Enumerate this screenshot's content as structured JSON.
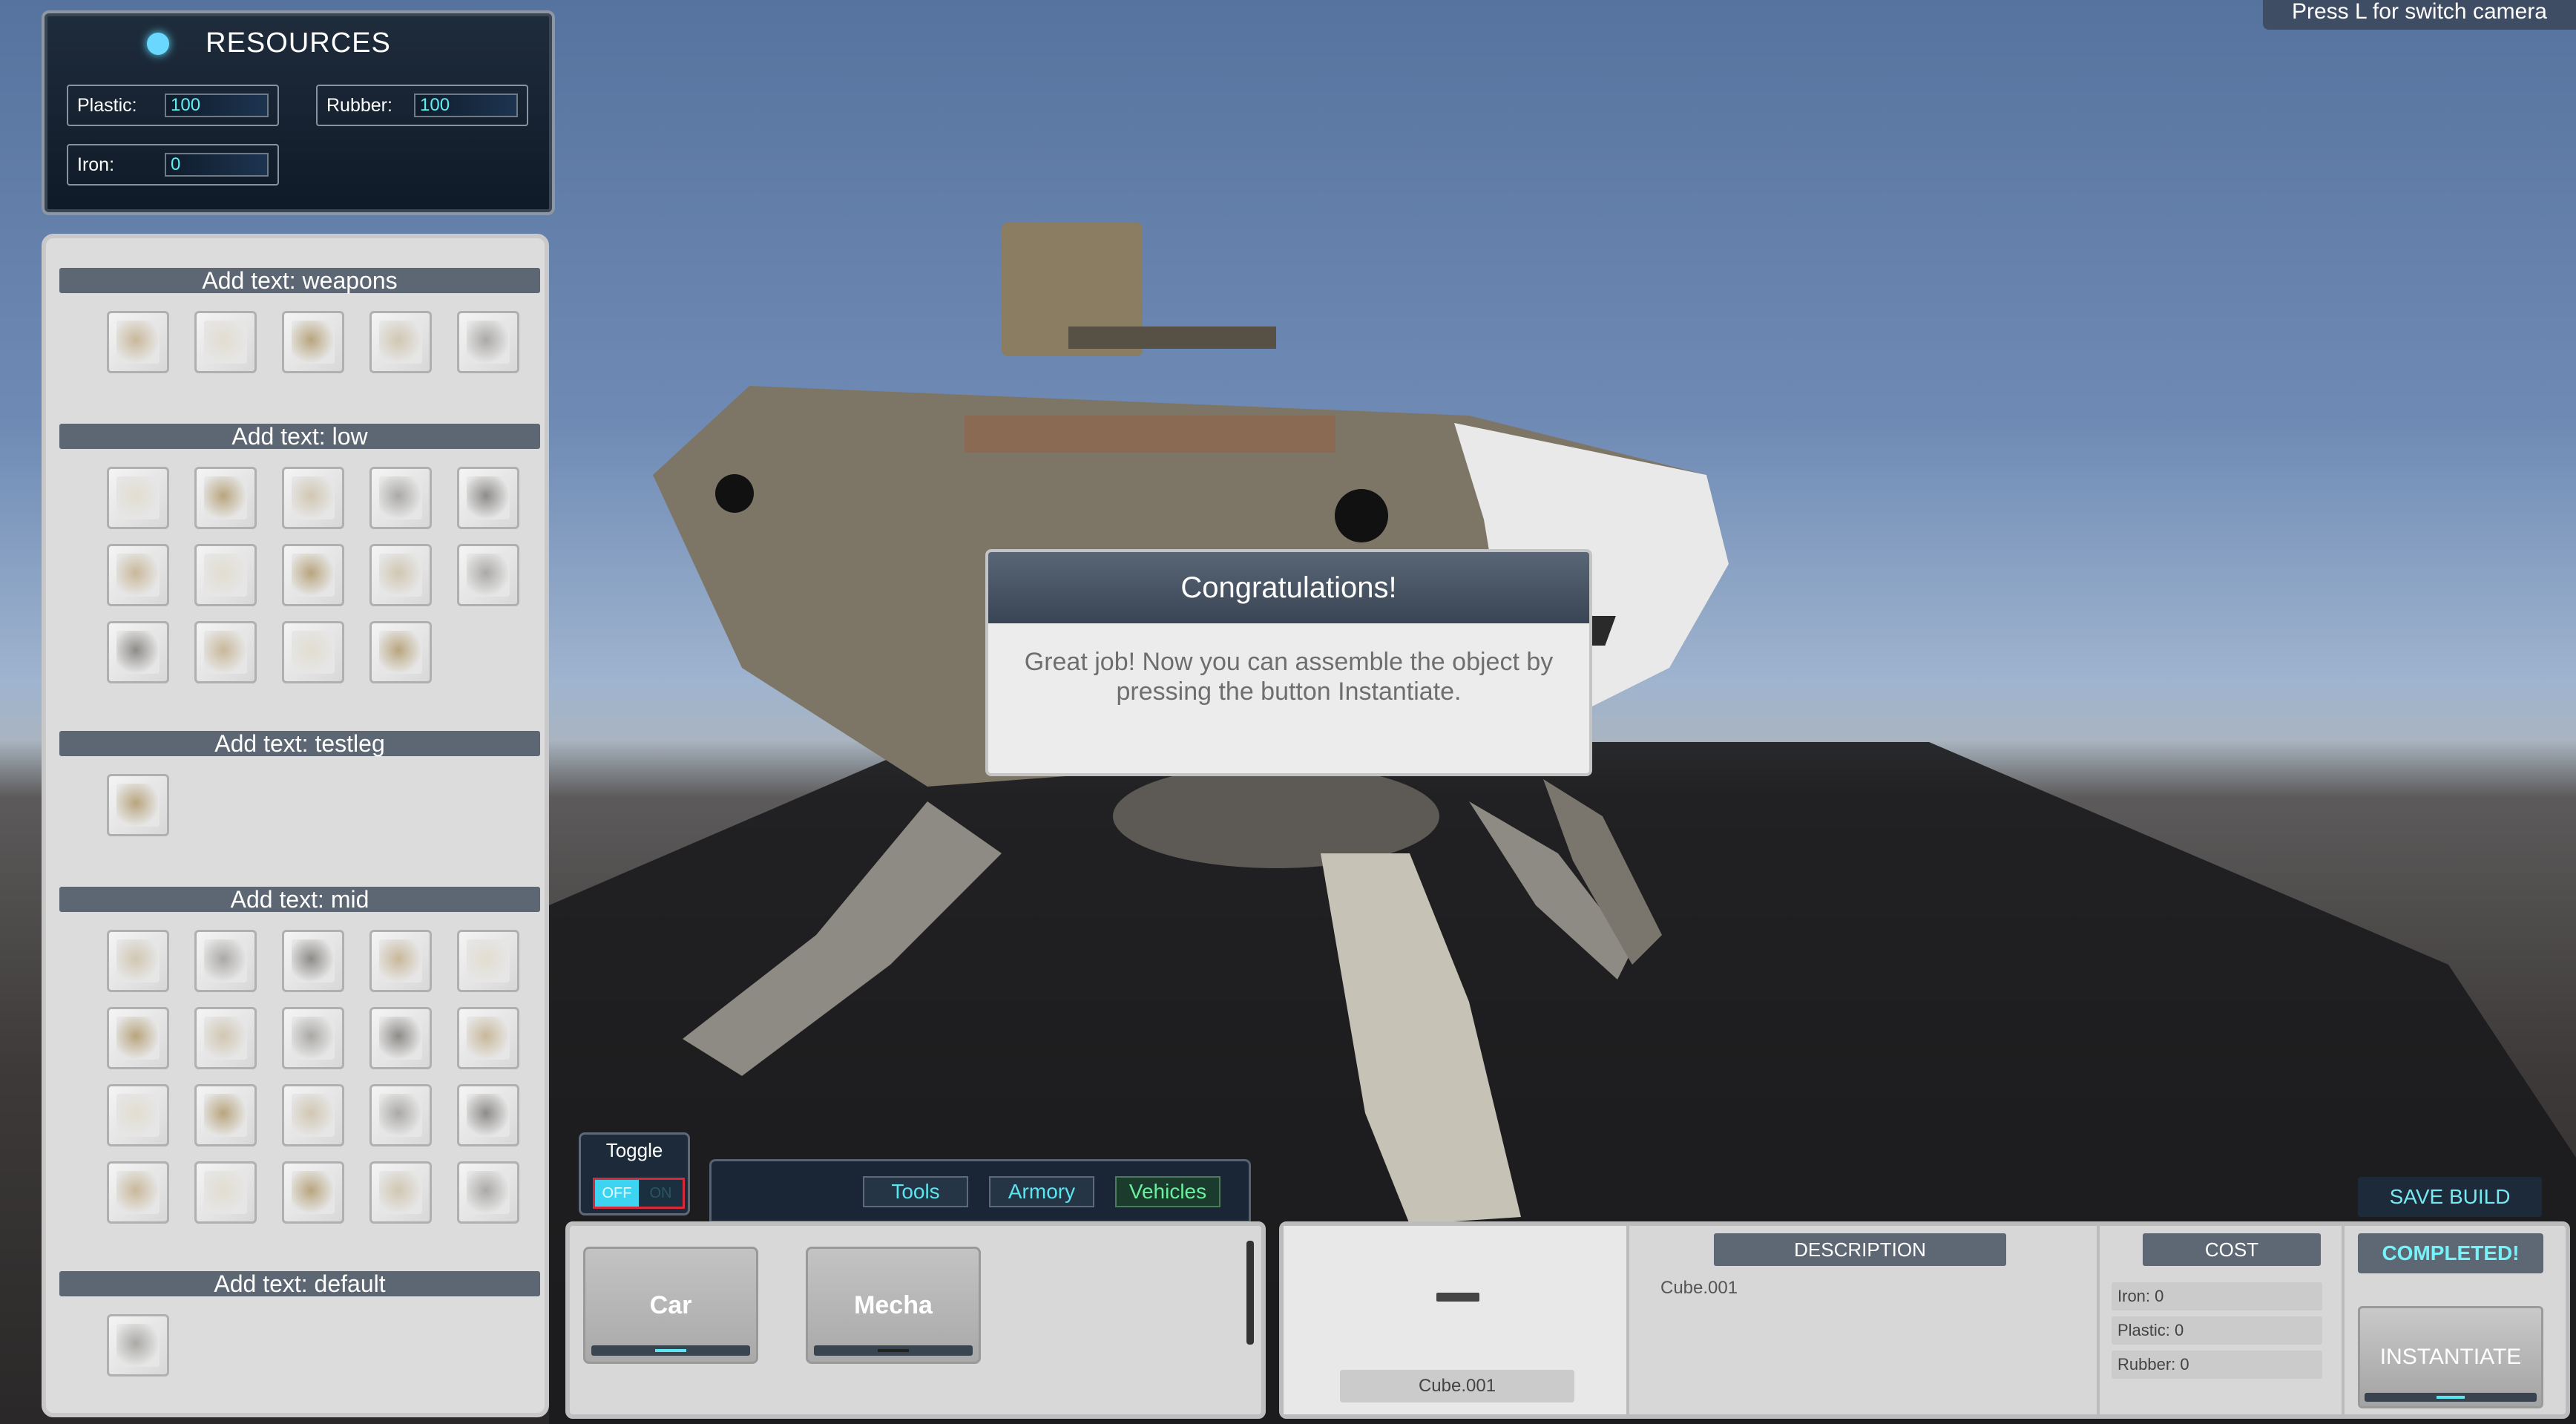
{
  "camera_tip": "Press L for switch camera",
  "resources": {
    "title": "RESOURCES",
    "fields": [
      {
        "label": "Plastic:",
        "value": "100"
      },
      {
        "label": "Rubber:",
        "value": "100"
      },
      {
        "label": "Iron:",
        "value": "0"
      }
    ]
  },
  "inventory": {
    "categories": [
      {
        "header": "Add text: weapons",
        "item_count": 5
      },
      {
        "header": "Add text: low",
        "item_count": 14
      },
      {
        "header": "Add text: testleg",
        "item_count": 1
      },
      {
        "header": "Add text: mid",
        "item_count": 20
      },
      {
        "header": "Add text: default",
        "item_count": 1
      }
    ]
  },
  "dialog": {
    "title": "Congratulations!",
    "message": "Great job! Now you can assemble the object by pressing the button Instantiate."
  },
  "toggle": {
    "label": "Toggle",
    "off": "OFF",
    "on": "ON",
    "state": "OFF"
  },
  "tabs": [
    "Tools",
    "Armory",
    "Vehicles"
  ],
  "active_tab": "Vehicles",
  "vehicles": [
    {
      "label": "Car",
      "selected": true
    },
    {
      "label": "Mecha",
      "selected": false
    }
  ],
  "details": {
    "preview_name": "Cube.001",
    "description_header": "DESCRIPTION",
    "description_text": "Cube.001",
    "cost_header": "COST",
    "costs": [
      "Iron: 0",
      "Plastic: 0",
      "Rubber: 0"
    ],
    "status": "COMPLETED!",
    "instantiate_label": "INSTANTIATE"
  },
  "save_build_label": "SAVE BUILD",
  "colors": {
    "accent_cyan": "#5ee6f0",
    "panel_dark": "#1a2636",
    "header_gray": "#5e6874"
  }
}
